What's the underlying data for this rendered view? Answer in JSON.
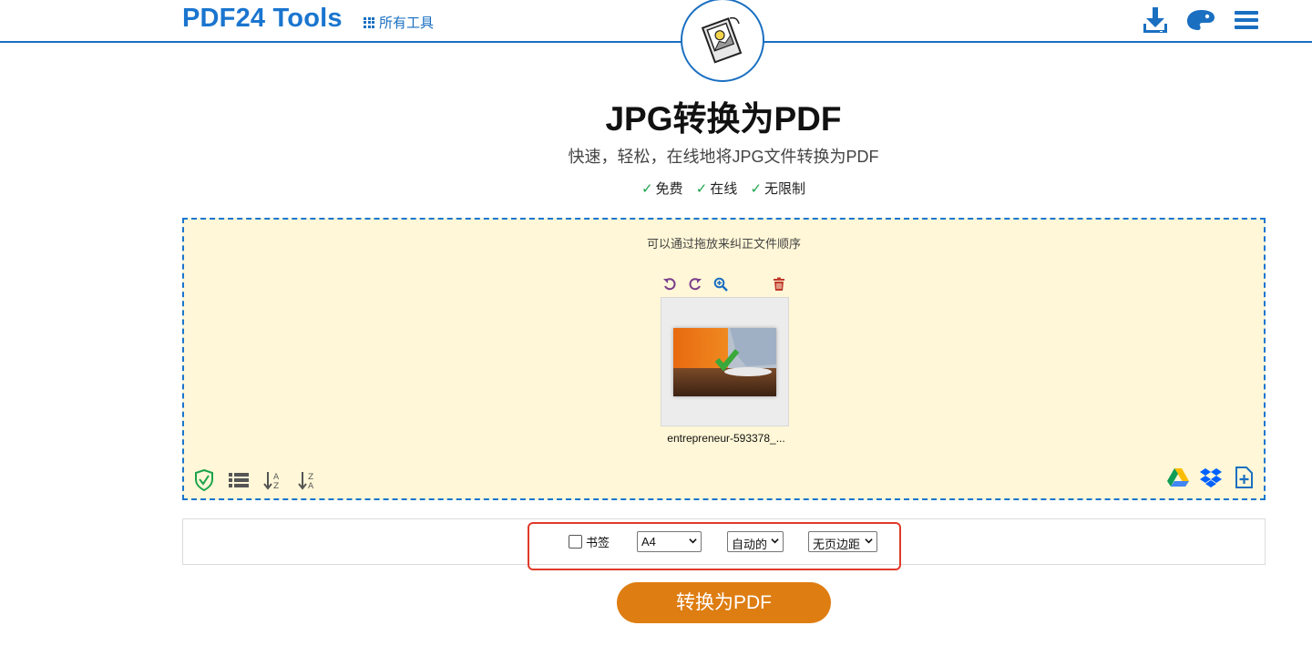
{
  "header": {
    "brand": "PDF24 Tools",
    "all_tools_label": "所有工具",
    "icons": [
      "download-icon",
      "palette-icon",
      "hamburger-menu-icon"
    ]
  },
  "hero": {
    "title": "JPG转换为PDF",
    "subtitle": "快速，轻松，在线地将JPG文件转换为PDF",
    "features": [
      "免费",
      "在线",
      "无限制"
    ]
  },
  "dropzone": {
    "hint": "可以通过拖放来纠正文件顺序",
    "file": {
      "name": "entrepreneur-593378_..."
    },
    "file_tools": [
      "rotate-left-icon",
      "rotate-right-icon",
      "zoom-in-icon",
      "trash-icon"
    ],
    "bottom_left_icons": [
      "shield-check-icon",
      "list-icon",
      "sort-az-icon",
      "sort-za-icon"
    ],
    "bottom_right_icons": [
      "google-drive-icon",
      "dropbox-icon",
      "add-file-icon"
    ]
  },
  "options": {
    "bookmark_label": "书签",
    "page_size": "A4",
    "orientation": "自动的",
    "margin": "无页边距"
  },
  "convert_button": "转换为PDF",
  "colors": {
    "brand_blue": "#1a75cf",
    "dropzone_bg": "#fff7d7",
    "button_orange": "#de7d12",
    "highlight_red": "#e03a2a",
    "check_green": "#1aa34a"
  }
}
